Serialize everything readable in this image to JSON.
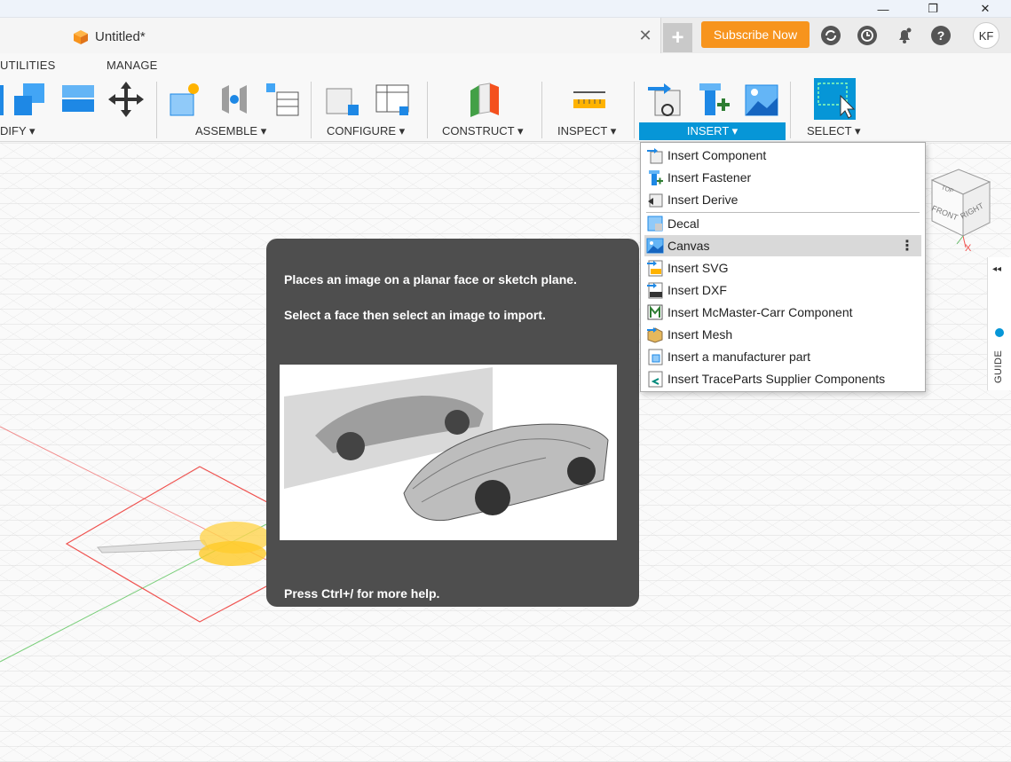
{
  "window": {
    "minimize_glyph": "—",
    "restore_glyph": "❐",
    "close_glyph": "✕"
  },
  "document": {
    "title": "Untitled*",
    "close_glyph": "✕",
    "new_tab_glyph": "+"
  },
  "header": {
    "subscribe_label": "Subscribe Now",
    "avatar_initials": "KF",
    "help_glyph": "?"
  },
  "workspace_tabs": [
    "UTILITIES",
    "MANAGE"
  ],
  "toolbar": {
    "modify_label": "DIFY ▾",
    "assemble_label": "ASSEMBLE ▾",
    "configure_label": "CONFIGURE ▾",
    "construct_label": "CONSTRUCT ▾",
    "inspect_label": "INSPECT ▾",
    "insert_label": "INSERT ▾",
    "select_label": "SELECT ▾"
  },
  "insert_menu": {
    "items": [
      {
        "label": "Insert Component",
        "icon": "insert-component-icon"
      },
      {
        "label": "Insert Fastener",
        "icon": "insert-fastener-icon"
      },
      {
        "label": "Insert Derive",
        "icon": "insert-derive-icon"
      },
      {
        "label": "Decal",
        "icon": "decal-icon"
      },
      {
        "label": "Canvas",
        "icon": "canvas-icon",
        "highlighted": true
      },
      {
        "label": "Insert SVG",
        "icon": "insert-svg-icon"
      },
      {
        "label": "Insert DXF",
        "icon": "insert-dxf-icon"
      },
      {
        "label": "Insert McMaster-Carr Component",
        "icon": "mcmaster-icon"
      },
      {
        "label": "Insert Mesh",
        "icon": "insert-mesh-icon"
      },
      {
        "label": "Insert a manufacturer part",
        "icon": "manufacturer-part-icon"
      },
      {
        "label": "Insert TraceParts Supplier Components",
        "icon": "traceparts-icon"
      }
    ],
    "more_glyph": "⋮"
  },
  "tooltip": {
    "line1": "Places an image on a planar face or sketch plane.",
    "line2": "Select a face then select an image to import.",
    "footer": "Press Ctrl+/ for more help."
  },
  "viewcube": {
    "top": "TOP",
    "front": "FRONT",
    "right": "RIGHT",
    "axis_x": "X"
  },
  "guide": {
    "label": "GUIDE",
    "collapse_glyph": "◂◂"
  },
  "colors": {
    "accent": "#0696d7",
    "subscribe": "#f7941d",
    "tooltip_bg": "#4e4e4e"
  }
}
